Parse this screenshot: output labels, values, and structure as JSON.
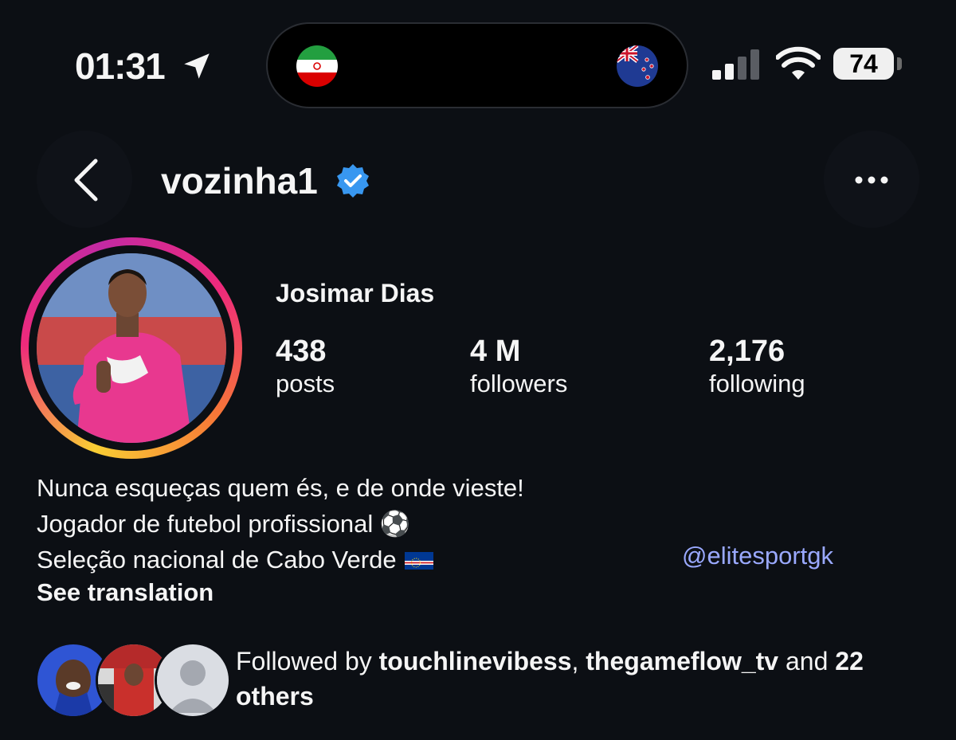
{
  "status_bar": {
    "time": "01:31",
    "battery": "74",
    "icons": [
      "location-arrow-icon",
      "signal-bars-icon",
      "wifi-icon",
      "battery-icon"
    ]
  },
  "live_activity": {
    "left_flag": "iran-flag",
    "right_flag": "new-zealand-flag"
  },
  "header": {
    "username": "vozinha1",
    "verified": true,
    "back_icon": "chevron-left-icon",
    "more_icon": "more-dots-icon"
  },
  "profile": {
    "full_name": "Josimar Dias",
    "stats": [
      {
        "value": "438",
        "label": "posts"
      },
      {
        "value": "4 M",
        "label": "followers"
      },
      {
        "value": "2,176",
        "label": "following"
      }
    ],
    "bio": [
      "Nunca esqueças quem és, e de onde vieste!",
      "Jogador de futebol profissional ⚽",
      "Seleção nacional de Cabo Verde"
    ],
    "bio_link": "@elitesportgk",
    "see_translation": "See translation"
  },
  "followed_by": {
    "prefix": "Followed by ",
    "user1": "touchlinevibess",
    "separator": ", ",
    "user2": "thegameflow_tv",
    "and_text": " and ",
    "count": "22",
    "suffix": "others"
  },
  "colors": {
    "background": "#0c0f14",
    "verified_blue": "#3897f0",
    "link": "#9aa9ff"
  }
}
